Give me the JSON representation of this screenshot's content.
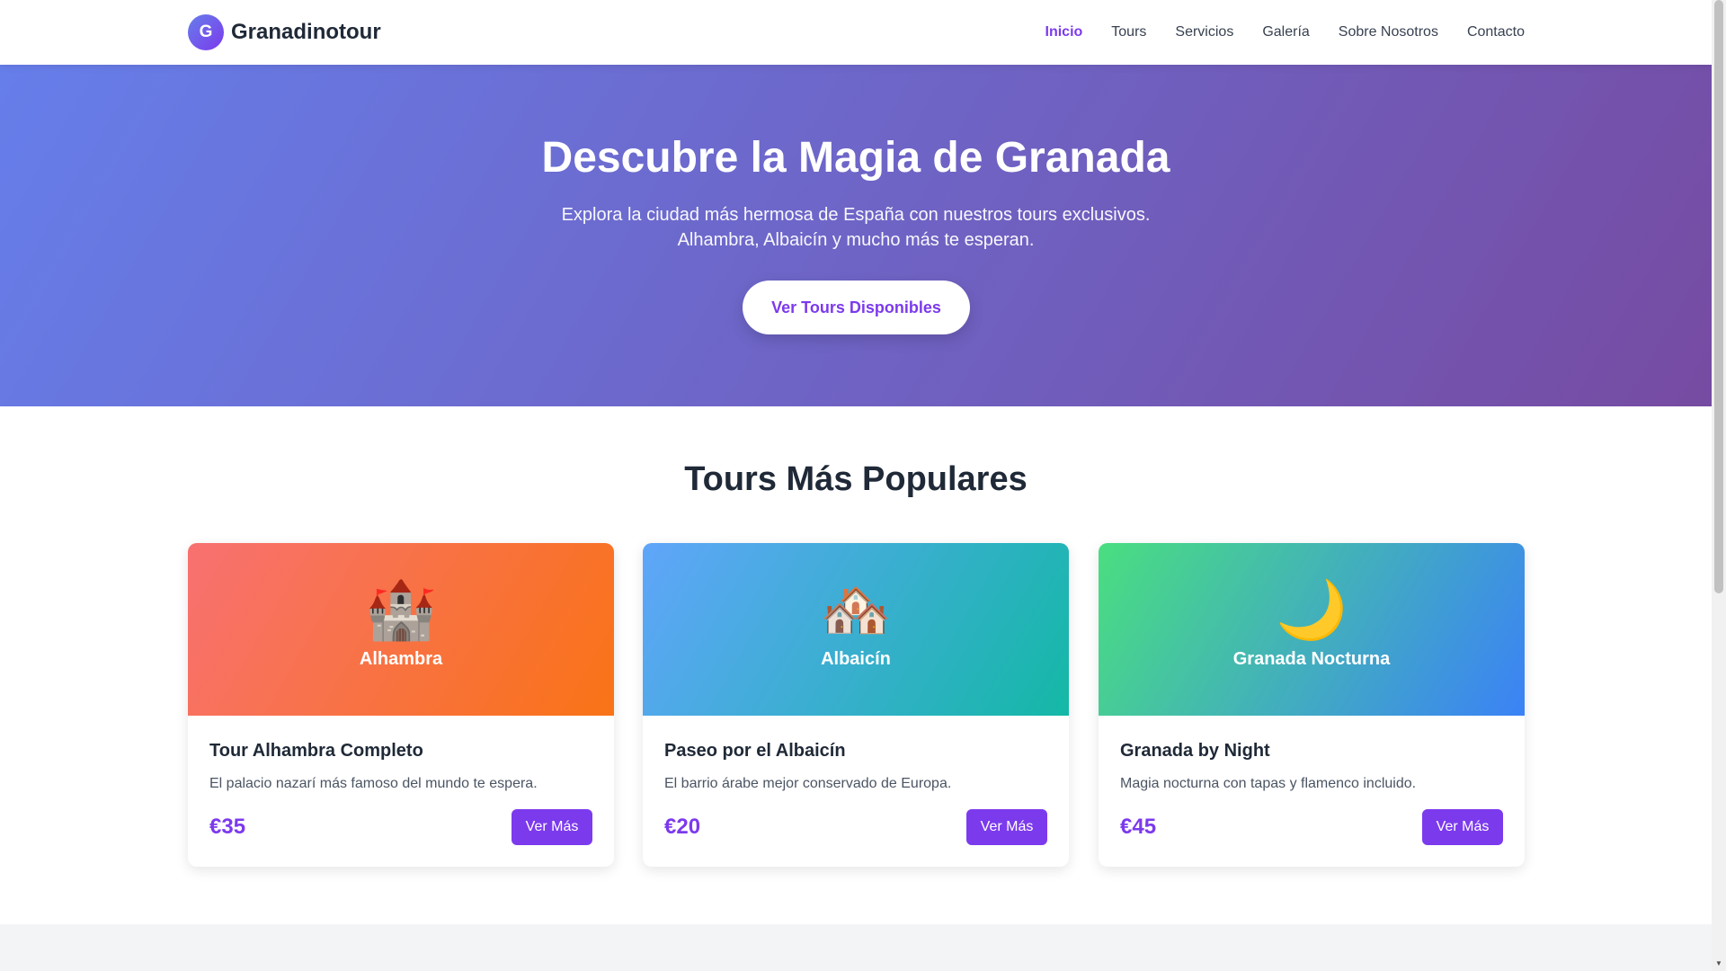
{
  "header": {
    "logo_letter": "G",
    "brand": "Granadinotour",
    "nav": [
      {
        "label": "Inicio",
        "active": true
      },
      {
        "label": "Tours"
      },
      {
        "label": "Servicios"
      },
      {
        "label": "Galería"
      },
      {
        "label": "Sobre Nosotros"
      },
      {
        "label": "Contacto"
      }
    ]
  },
  "hero": {
    "title": "Descubre la Magia de Granada",
    "subtitle_line1": "Explora la ciudad más hermosa de España con nuestros tours exclusivos.",
    "subtitle_line2": "Alhambra, Albaicín y mucho más te esperan.",
    "cta": "Ver Tours Disponibles"
  },
  "tours": {
    "title": "Tours Más Populares",
    "cards": [
      {
        "emoji": "🏰",
        "place": "Alhambra",
        "title": "Tour Alhambra Completo",
        "description": "El palacio nazarí más famoso del mundo te espera.",
        "price": "€35",
        "button": "Ver Más",
        "gradient": [
          "#f87171",
          "#f97316"
        ]
      },
      {
        "emoji": "🏘️",
        "place": "Albaicín",
        "title": "Paseo por el Albaicín",
        "description": "El barrio árabe mejor conservado de Europa.",
        "price": "€20",
        "button": "Ver Más",
        "gradient": [
          "#60a5fa",
          "#14b8a6"
        ]
      },
      {
        "emoji": "🌙",
        "place": "Granada Nocturna",
        "title": "Granada by Night",
        "description": "Magia nocturna con tapas y flamenco incluido.",
        "price": "€45",
        "button": "Ver Más",
        "gradient": [
          "#4ade80",
          "#3b82f6"
        ]
      }
    ]
  },
  "colors": {
    "accent": "#7c3aed",
    "hero_start": "#667eea",
    "hero_end": "#764ba2"
  }
}
